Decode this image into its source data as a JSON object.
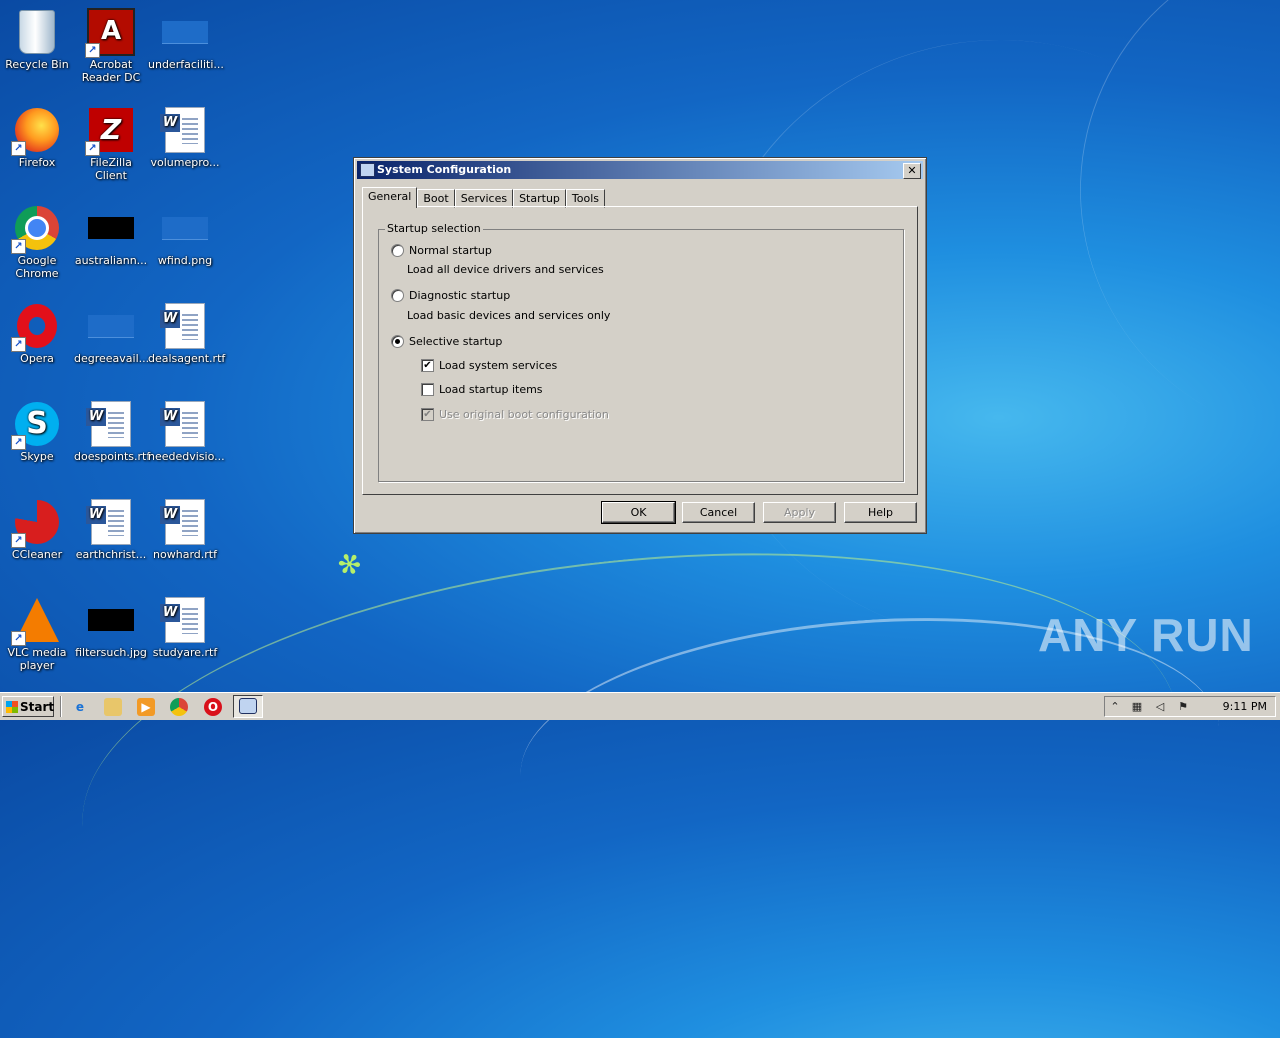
{
  "desktop": {
    "icons": [
      {
        "label": "Recycle Bin"
      },
      {
        "label": "Acrobat Reader DC"
      },
      {
        "label": "underfaciliti..."
      },
      {
        "label": "Firefox"
      },
      {
        "label": "FileZilla Client"
      },
      {
        "label": "volumepro..."
      },
      {
        "label": "Google Chrome"
      },
      {
        "label": "australiann..."
      },
      {
        "label": "wfind.png"
      },
      {
        "label": "Opera"
      },
      {
        "label": "degreeavail..."
      },
      {
        "label": "dealsagent.rtf"
      },
      {
        "label": "Skype"
      },
      {
        "label": "doespoints.rtf"
      },
      {
        "label": "neededvisio..."
      },
      {
        "label": "CCleaner"
      },
      {
        "label": "earthchrist..."
      },
      {
        "label": "nowhard.rtf"
      },
      {
        "label": "VLC media player"
      },
      {
        "label": "filtersuch.jpg"
      },
      {
        "label": "studyare.rtf"
      }
    ],
    "watermark": "ANY RUN"
  },
  "dialog": {
    "title": "System Configuration",
    "close": "✕",
    "tabs": [
      "General",
      "Boot",
      "Services",
      "Startup",
      "Tools"
    ],
    "active_tab": "General",
    "group_label": "Startup selection",
    "normal_label": "Normal startup",
    "normal_desc": "Load all device drivers and services",
    "diagnostic_label": "Diagnostic startup",
    "diagnostic_desc": "Load basic devices and services only",
    "selective_label": "Selective startup",
    "selected": "selective",
    "load_system_services": "Load system services",
    "load_system_services_checked": true,
    "load_startup_items": "Load startup items",
    "load_startup_items_checked": false,
    "use_original_boot": "Use original boot configuration",
    "use_original_boot_checked": true,
    "buttons": {
      "ok": "OK",
      "cancel": "Cancel",
      "apply": "Apply",
      "help": "Help"
    }
  },
  "taskbar": {
    "start": "Start",
    "clock": "9:11 PM"
  }
}
